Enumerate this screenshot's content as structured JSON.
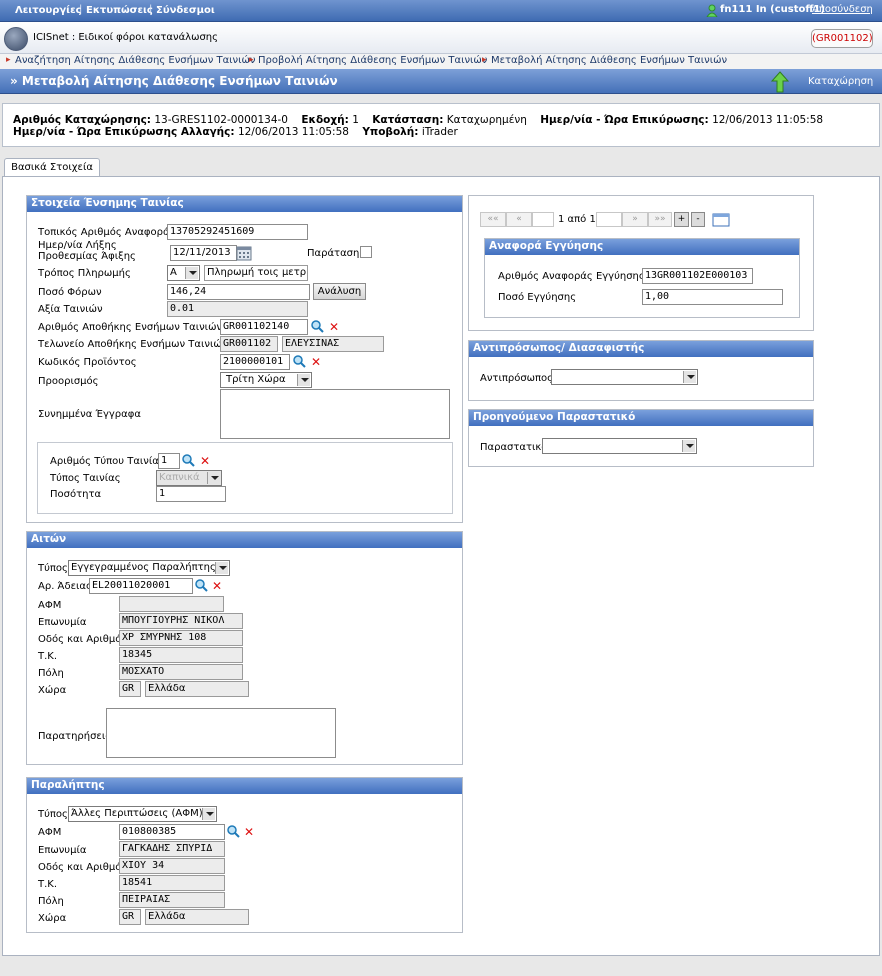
{
  "menu": {
    "items": [
      "Λειτουργίες",
      "Εκτυπώσεις",
      "Σύνδεσμοι"
    ],
    "user": "fn111 In (custoff1)",
    "logout": "Αποσύνδεση"
  },
  "header": {
    "app_title": "ICISnet : Ειδικοί φόροι κατανάλωσης",
    "org_code": "(GR001102)"
  },
  "breadcrumb": [
    "Αναζήτηση Αίτησης Διάθεσης Ενσήμων Ταινιών",
    "Προβολή Αίτησης Διάθεσης Ενσήμων Ταινιών",
    "Μεταβολή Αίτησης Διάθεσης Ενσήμων Ταινιών"
  ],
  "page": {
    "title": "» Μεταβολή Αίτησης Διάθεσης Ενσήμων Ταινιών",
    "register_label": "Καταχώρηση"
  },
  "info": {
    "reg_no_label": "Αριθμός Καταχώρησης:",
    "reg_no": "13-GRES1102-0000134-0",
    "version_label": "Εκδοχή:",
    "version": "1",
    "status_label": "Κατάσταση:",
    "status": "Καταχωρημένη",
    "validation_label": "Ημερ/νία - Ώρα Επικύρωσης:",
    "validation": "12/06/2013 11:05:58",
    "change_validation_label": "Ημερ/νία - Ώρα Επικύρωσης Αλλαγής:",
    "change_validation": "12/06/2013 11:05:58",
    "submission_label": "Υποβολή:",
    "submission": "iTrader"
  },
  "tab": "Βασικά Στοιχεία",
  "stamp": {
    "title": "Στοιχεία Ένσημης Ταινίας",
    "local_ref_label": "Τοπικός Αριθμός Αναφοράς",
    "local_ref": "13705292451609",
    "deadline_label": "Ημερ/νία Λήξης Προθεσμίας Άφιξης",
    "deadline": "12/11/2013",
    "extension_label": "Παράταση",
    "payment_label": "Τρόπος Πληρωμής",
    "payment_code": "A",
    "payment_desc": "Πληρωμή τοις μετρητο",
    "tax_label": "Ποσό Φόρων",
    "tax": "146,24",
    "analysis_btn": "Ανάλυση",
    "stamps_value_label": "Αξία Ταινιών",
    "stamps_value": "0.01",
    "warehouse_label": "Αριθμός Αποθήκης Ενσήμων Ταινιών",
    "warehouse": "GR001102140",
    "customs_label": "Τελωνείο Αποθήκης Ενσήμων Ταινιών",
    "customs_code": "GR001102",
    "customs_name": "ΕΛΕΥΣΙΝΑΣ",
    "product_label": "Κωδικός Προϊόντος",
    "product": "2100000101",
    "destination_label": "Προορισμός",
    "destination": "Τρίτη Χώρα",
    "attachments_label": "Συνημμένα Έγγραφα",
    "type_no_label": "Αριθμός Τύπου Ταινίας",
    "type_no": "1",
    "type_label": "Τύπος Ταινίας",
    "type_value": "Καπνικά",
    "quantity_label": "Ποσότητα",
    "quantity": "1"
  },
  "pager": {
    "text": "1 από 1",
    "first": "«« ",
    "prev": "«",
    "next": "»",
    "last": "»»"
  },
  "guarantee": {
    "title": "Αναφορά Εγγύησης",
    "ref_label": "Αριθμός Αναφοράς Εγγύησης",
    "ref": "13GR001102E000103",
    "amount_label": "Ποσό Εγγύησης",
    "amount": "1,00"
  },
  "representative": {
    "title": "Αντιπρόσωπος/ Διασαφιστής",
    "label": "Αντιπρόσωπος",
    "value": ""
  },
  "previous_doc": {
    "title": "Προηγούμενο Παραστατικό",
    "label": "Παραστατικό",
    "value": ""
  },
  "sender": {
    "title": "Αιτών",
    "type_label": "Τύπος",
    "type": "Εγγεγραμμένος Παραλήπτης",
    "license_label": "Αρ. Άδειας",
    "license": "EL20011020001",
    "afm_label": "ΑΦΜ",
    "afm": "",
    "name_label": "Επωνυμία",
    "name": "ΜΠΟΥΓΙΟΥΡΗΣ ΝΙΚΟΛ",
    "street_label": "Οδός και Αριθμός",
    "street": "ΧΡ ΣΜΥΡΝΗΣ 108",
    "zip_label": "Τ.Κ.",
    "zip": "18345",
    "city_label": "Πόλη",
    "city": "ΜΟΣΧΑΤΟ",
    "country_label": "Χώρα",
    "country_code": "GR",
    "country": "Ελλάδα",
    "notes_label": "Παρατηρήσεις"
  },
  "receiver": {
    "title": "Παραλήπτης",
    "type_label": "Τύπος",
    "type": "Άλλες Περιπτώσεις (ΑΦΜ)",
    "afm_label": "ΑΦΜ",
    "afm": "010800385",
    "name_label": "Επωνυμία",
    "name": "ΓΑΓΚΑΔΗΣ ΣΠΥΡΙΔ",
    "street_label": "Οδός και Αριθμός",
    "street": "ΧΙΟΥ 34",
    "zip_label": "Τ.Κ.",
    "zip": "18541",
    "city_label": "Πόλη",
    "city": "ΠΕΙΡΑΙΑΣ",
    "country_label": "Χώρα",
    "country_code": "GR",
    "country": "Ελλάδα"
  },
  "colors": {
    "header_blue": "#4470b8",
    "delete_red": "#d11111",
    "org_code_red": "#cc0000"
  }
}
